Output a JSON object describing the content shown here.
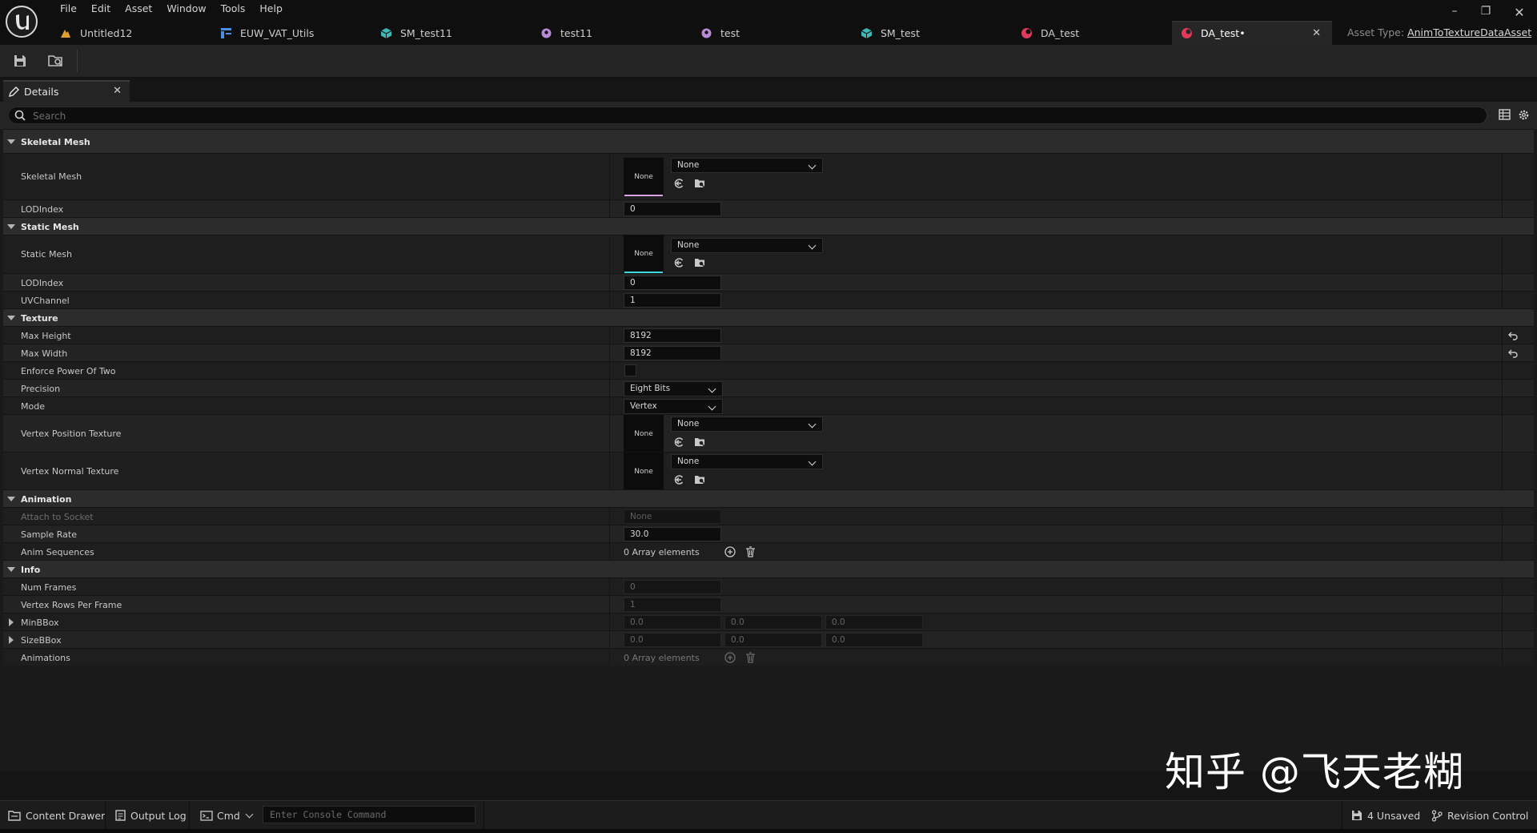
{
  "menu": [
    "File",
    "Edit",
    "Asset",
    "Window",
    "Tools",
    "Help"
  ],
  "tabs": [
    {
      "label": "Untitled12",
      "icon": "level-icon"
    },
    {
      "label": "EUW_VAT_Utils",
      "icon": "widget-blueprint-icon"
    },
    {
      "label": "SM_test11",
      "icon": "static-mesh-icon"
    },
    {
      "label": "test11",
      "icon": "skeleton-icon"
    },
    {
      "label": "test",
      "icon": "skeleton-icon"
    },
    {
      "label": "SM_test",
      "icon": "static-mesh-icon"
    },
    {
      "label": "DA_test",
      "icon": "data-asset-icon"
    },
    {
      "label": "DA_test•",
      "icon": "data-asset-icon"
    }
  ],
  "asset_type": {
    "label": "Asset Type:",
    "value": "AnimToTextureDataAsset"
  },
  "details_tab": {
    "label": "Details"
  },
  "search": {
    "placeholder": "Search"
  },
  "categories": {
    "skeletal_mesh": "Skeletal Mesh",
    "static_mesh": "Static Mesh",
    "texture": "Texture",
    "animation": "Animation",
    "info": "Info"
  },
  "props": {
    "skeletal_mesh": {
      "label": "Skeletal Mesh",
      "thumb": "None",
      "value": "None"
    },
    "sk_lod": {
      "label": "LODIndex",
      "value": "0"
    },
    "static_mesh": {
      "label": "Static Mesh",
      "thumb": "None",
      "value": "None"
    },
    "sm_lod": {
      "label": "LODIndex",
      "value": "0"
    },
    "uv_channel": {
      "label": "UVChannel",
      "value": "1"
    },
    "max_height": {
      "label": "Max Height",
      "value": "8192"
    },
    "max_width": {
      "label": "Max Width",
      "value": "8192"
    },
    "enforce_pow2": {
      "label": "Enforce Power Of Two",
      "checked": false
    },
    "precision": {
      "label": "Precision",
      "value": "Eight Bits"
    },
    "mode": {
      "label": "Mode",
      "value": "Vertex"
    },
    "vertex_position_texture": {
      "label": "Vertex Position Texture",
      "thumb": "None",
      "value": "None"
    },
    "vertex_normal_texture": {
      "label": "Vertex Normal Texture",
      "thumb": "None",
      "value": "None"
    },
    "attach_socket": {
      "label": "Attach to Socket",
      "value": "None"
    },
    "sample_rate": {
      "label": "Sample Rate",
      "value": "30.0"
    },
    "anim_sequences": {
      "label": "Anim Sequences",
      "value": "0 Array elements"
    },
    "num_frames": {
      "label": "Num Frames",
      "value": "0"
    },
    "vertex_rows": {
      "label": "Vertex Rows Per Frame",
      "value": "1"
    },
    "min_bbox": {
      "label": "MinBBox",
      "x": "0.0",
      "y": "0.0",
      "z": "0.0"
    },
    "size_bbox": {
      "label": "SizeBBox",
      "x": "0.0",
      "y": "0.0",
      "z": "0.0"
    },
    "animations": {
      "label": "Animations",
      "value": "0 Array elements"
    }
  },
  "colors": {
    "skeletal_mesh": "#d9a3e6",
    "static_mesh": "#3fd8d8",
    "texture": "#c94040"
  },
  "watermark": "知乎 @飞天老糊",
  "statusbar": {
    "content_drawer": "Content Drawer",
    "output_log": "Output Log",
    "cmd": "Cmd",
    "console_placeholder": "Enter Console Command",
    "unsaved": "4 Unsaved",
    "revision_control": "Revision Control"
  }
}
